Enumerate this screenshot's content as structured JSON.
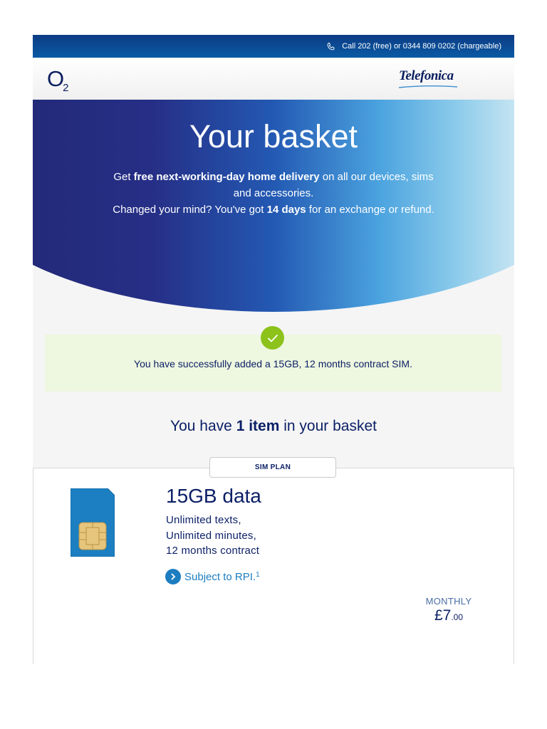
{
  "header": {
    "phone_text": "Call 202 (free) or 0344 809 0202 (chargeable)",
    "phone_icon": "phone-icon"
  },
  "brand": {
    "o2_letter": "O",
    "o2_sub": "2",
    "partner": "Telefonica"
  },
  "hero": {
    "title": "Your basket",
    "line1_pre": "Get ",
    "line1_bold": "free next-working-day home delivery",
    "line1_post": " on all our devices, sims and accessories.",
    "line2_pre": "Changed your mind? You've got ",
    "line2_bold": "14 days",
    "line2_post": " for an exchange or refund."
  },
  "notice": {
    "icon": "check-icon",
    "text": "You have successfully added a 15GB, 12 months contract SIM."
  },
  "basket": {
    "pre": "You have ",
    "bold": "1 item",
    "post": " in your basket"
  },
  "item": {
    "tab_label": "SIM PLAN",
    "title": "15GB data",
    "features": [
      "Unlimited texts,",
      "Unlimited minutes,",
      "12 months contract"
    ],
    "rpi_label": "Subject to RPI.",
    "rpi_sup": "1",
    "price_label": "MONTHLY",
    "price_major": "£7",
    "price_minor": ".00"
  },
  "colors": {
    "brand_navy": "#0b1f66",
    "link_blue": "#1c7dc0",
    "success_green": "#8cc21a",
    "success_bg": "#eef7df"
  }
}
